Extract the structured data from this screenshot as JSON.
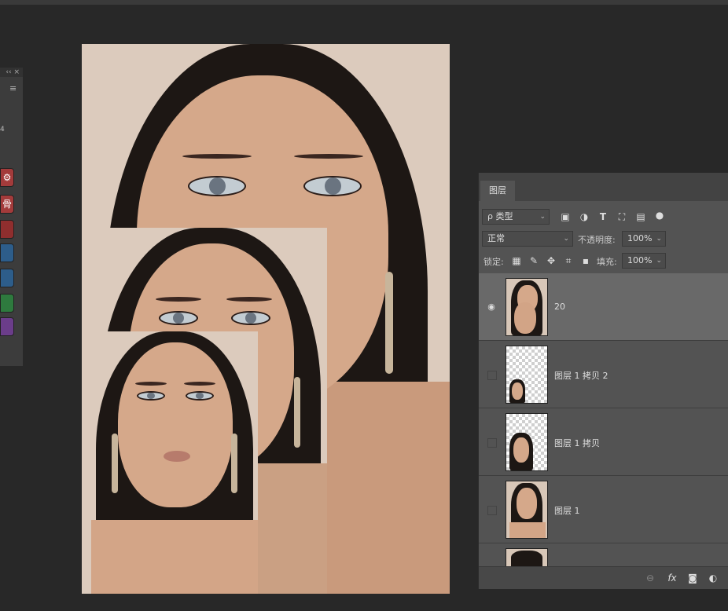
{
  "left_panel": {
    "header_glyph": "‹‹ ×",
    "menu_glyph": "≡",
    "number": "4",
    "buttons": [
      {
        "glyph": "⚙",
        "color": "#a33b3b"
      },
      {
        "glyph": "骨",
        "color": "#a33b3b"
      },
      {
        "glyph": "",
        "color": "#8f2e2e"
      },
      {
        "glyph": "",
        "color": "#2d5d8a"
      },
      {
        "glyph": "",
        "color": "#2d5d8a"
      },
      {
        "glyph": "",
        "color": "#2e7a3e"
      },
      {
        "glyph": "",
        "color": "#6b3d8a"
      }
    ]
  },
  "layers_panel": {
    "tab_label": "图层",
    "filter": {
      "label": "ρ 类型"
    },
    "blend_mode": "正常",
    "opacity_label": "不透明度:",
    "opacity_value": "100%",
    "lock_label": "锁定:",
    "fill_label": "填充:",
    "fill_value": "100%",
    "layers": [
      {
        "name": "20",
        "visible": true,
        "selected": true
      },
      {
        "name": "图层 1 拷贝 2",
        "visible": false,
        "selected": false
      },
      {
        "name": "图层 1 拷贝",
        "visible": false,
        "selected": false
      },
      {
        "name": "图层 1",
        "visible": false,
        "selected": false
      }
    ],
    "footer_icons": [
      "link-icon",
      "fx-icon",
      "mask-icon",
      "adjustment-icon"
    ],
    "footer_fx": "fx"
  }
}
